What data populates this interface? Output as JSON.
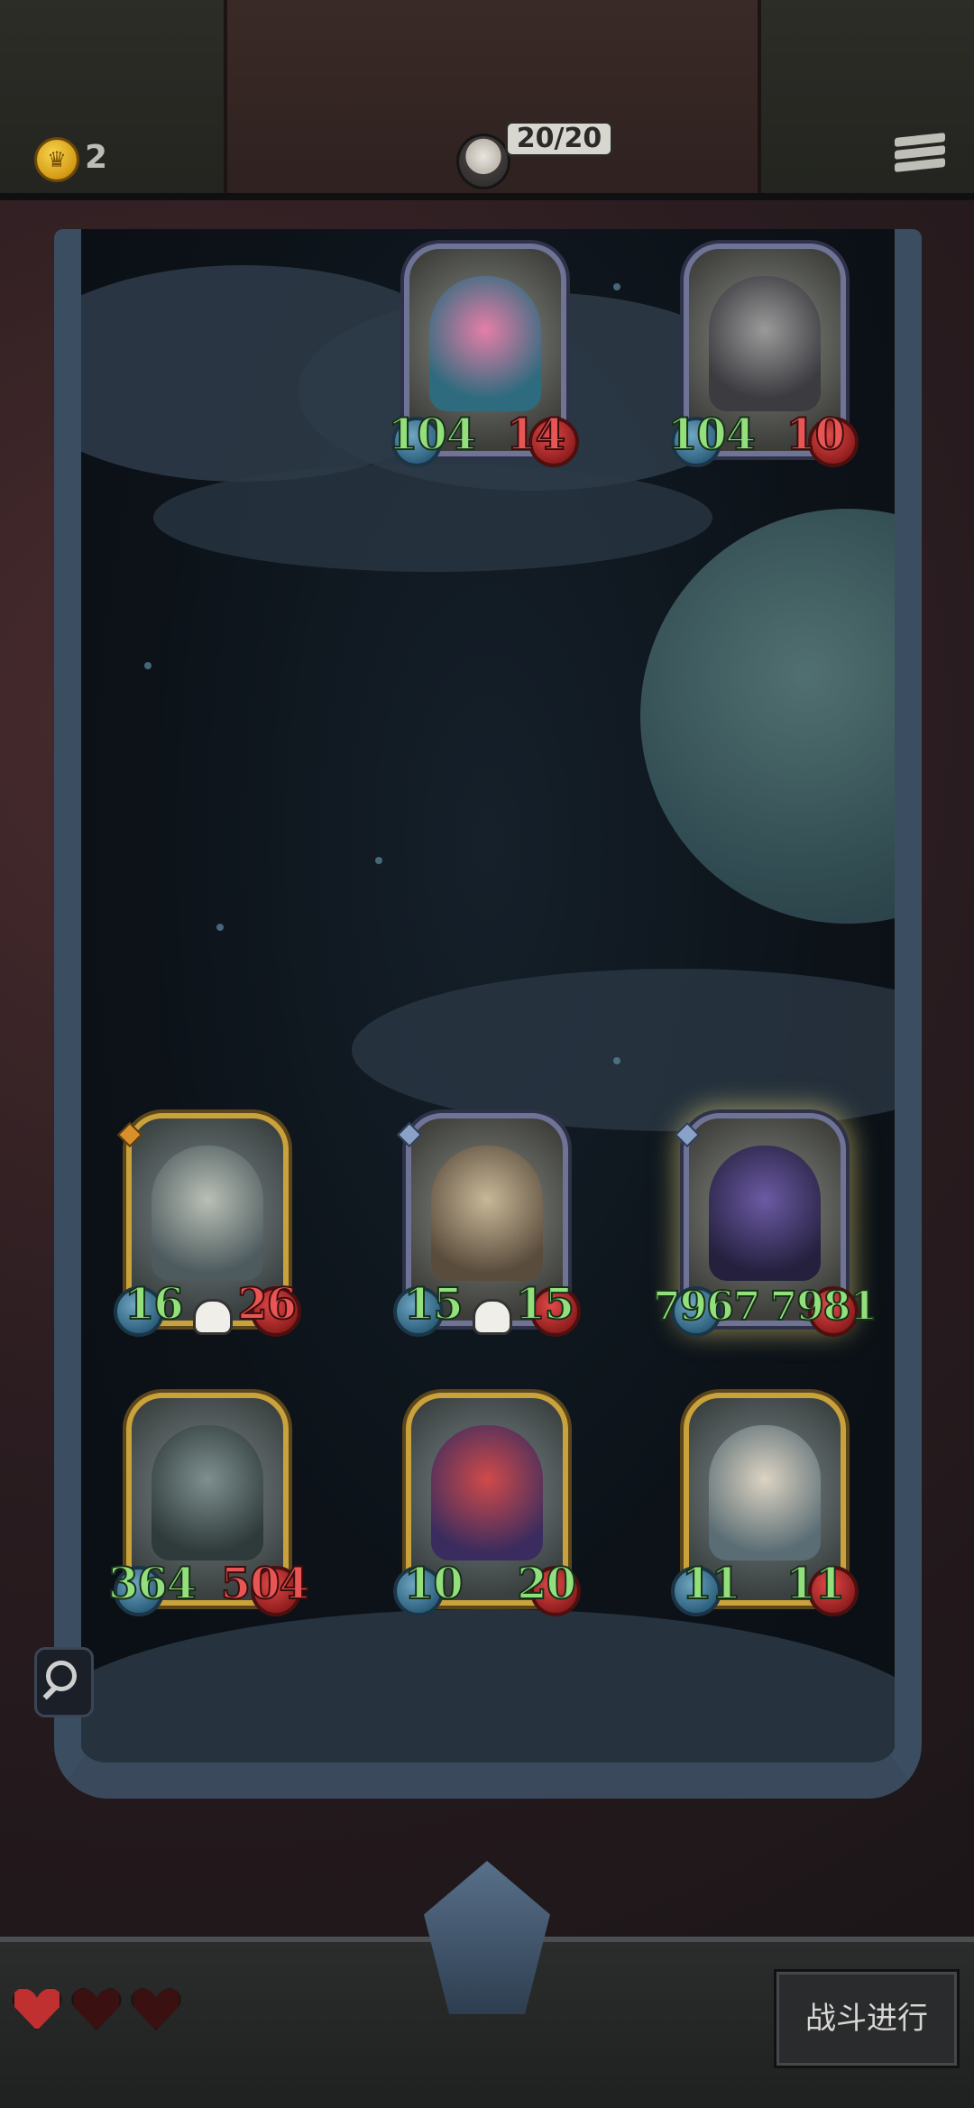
{
  "header": {
    "coins": "2",
    "coin_icon": "crown-coin-icon",
    "lives_counter": "20/20",
    "menu_icon": "hamburger-menu-icon"
  },
  "enemy_row": [
    {
      "name": "pink-haired-pirate-girl",
      "atk": "104",
      "hp": "14",
      "hp_color": "red",
      "frame": "silver"
    },
    {
      "name": "horned-chained-beast",
      "atk": "104",
      "hp": "10",
      "hp_color": "red",
      "frame": "silver"
    }
  ],
  "player_row1": [
    {
      "name": "bandaged-brute",
      "atk": "16",
      "hp": "26",
      "hp_color": "red",
      "frame": "gold",
      "skull": true,
      "gem": "orange"
    },
    {
      "name": "airship-bomb",
      "atk": "15",
      "hp": "15",
      "hp_color": "green",
      "frame": "silver",
      "skull": true,
      "gem": "blue"
    },
    {
      "name": "purple-wizard",
      "atk": "7967",
      "hp": "7981",
      "hp_color": "green",
      "frame": "silver",
      "glow": true,
      "gem": "blue"
    }
  ],
  "player_row2": [
    {
      "name": "iron-golem",
      "atk": "364",
      "hp": "504",
      "hp_color": "red",
      "frame": "gold"
    },
    {
      "name": "striped-clown",
      "atk": "10",
      "hp": "20",
      "hp_color": "green",
      "frame": "gold"
    },
    {
      "name": "bone-dragon",
      "atk": "11",
      "hp": "11",
      "hp_color": "green",
      "frame": "gold"
    }
  ],
  "footer": {
    "hearts": [
      {
        "state": "full"
      },
      {
        "state": "empty"
      },
      {
        "state": "empty"
      }
    ],
    "battle_button": "战斗进行"
  },
  "colors": {
    "atk_text": "#92df7c",
    "hp_red_text": "#e85555",
    "gold_frame": "#c9a23c",
    "silver_frame": "#6f7496"
  }
}
